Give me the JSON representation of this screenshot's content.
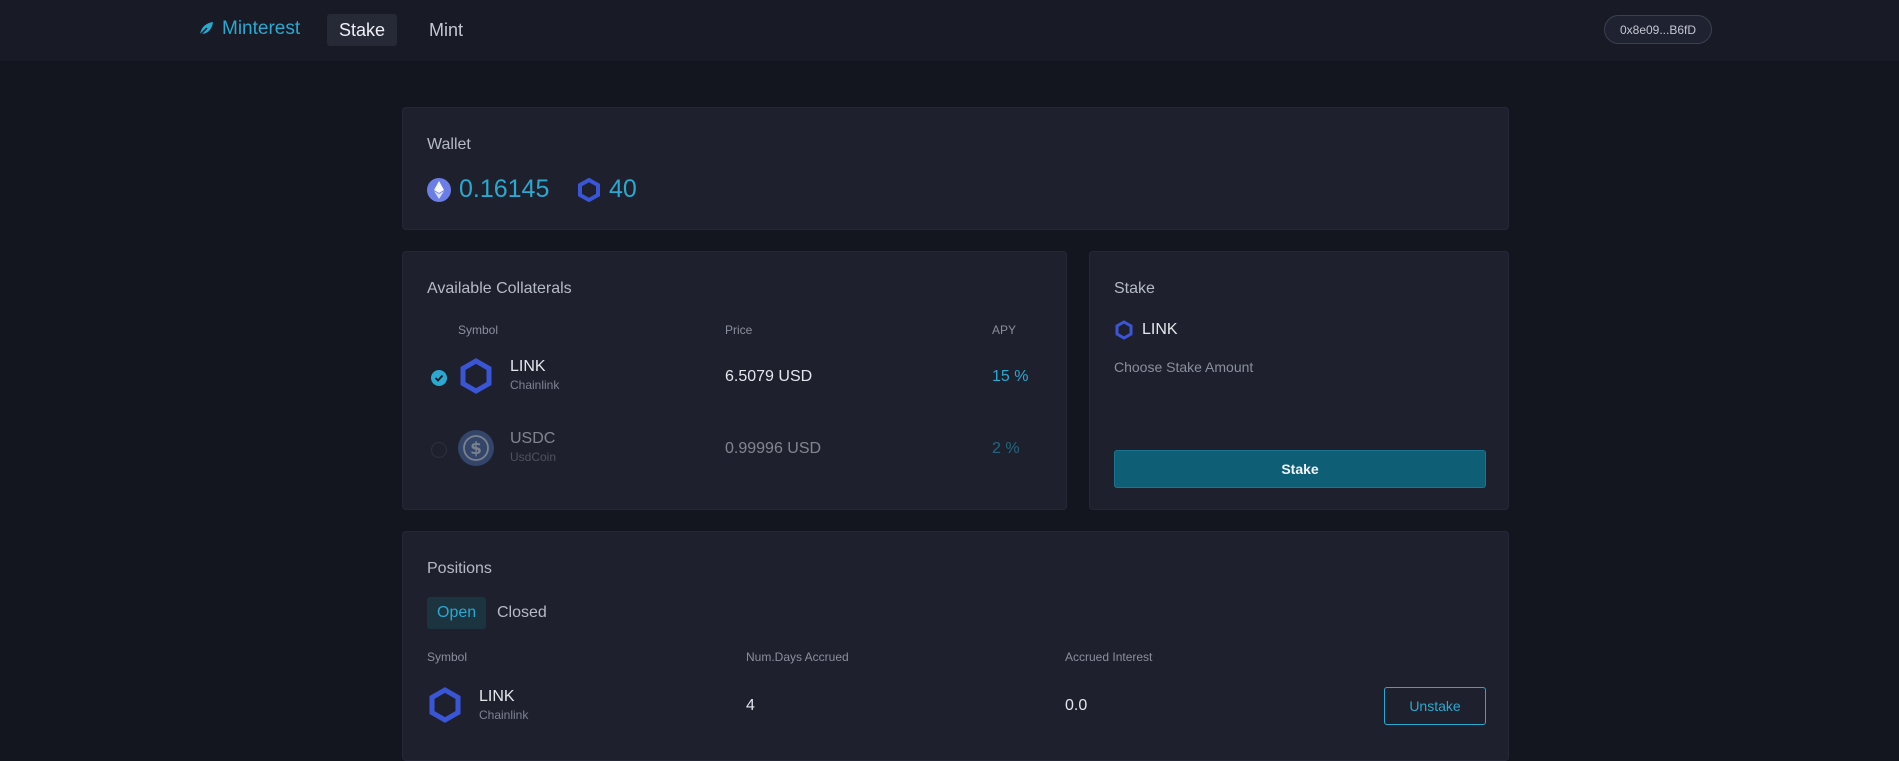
{
  "topbar": {
    "brand": "Minterest",
    "nav": {
      "stake": "Stake",
      "mint": "Mint"
    },
    "wallet_address": "0x8e09...B6fD"
  },
  "wallet": {
    "title": "Wallet",
    "eth_balance": "0.16145",
    "link_balance": "40"
  },
  "collaterals": {
    "title": "Available Collaterals",
    "headers": {
      "symbol": "Symbol",
      "price": "Price",
      "apy": "APY"
    },
    "rows": [
      {
        "symbol": "LINK",
        "name": "Chainlink",
        "price": "6.5079 USD",
        "apy": "15 %",
        "selected": true
      },
      {
        "symbol": "USDC",
        "name": "UsdCoin",
        "price": "0.99996 USD",
        "apy": "2 %",
        "selected": false
      }
    ]
  },
  "stake": {
    "title": "Stake",
    "asset": "LINK",
    "hint": "Choose Stake Amount",
    "button": "Stake"
  },
  "positions": {
    "title": "Positions",
    "tabs": {
      "open": "Open",
      "closed": "Closed"
    },
    "headers": {
      "symbol": "Symbol",
      "days": "Num.Days Accrued",
      "interest": "Accrued Interest"
    },
    "rows": [
      {
        "symbol": "LINK",
        "name": "Chainlink",
        "days": "4",
        "interest": "0.0",
        "action": "Unstake"
      }
    ]
  },
  "icons": {
    "brand": "leaf-icon",
    "eth": "ethereum-icon",
    "link": "chainlink-icon",
    "usdc": "usdc-icon"
  },
  "colors": {
    "accent": "#2aa8cf",
    "background": "#13151f",
    "card": "#1e212d",
    "button": "#0e5f76",
    "chainlink": "#3a55d6"
  }
}
